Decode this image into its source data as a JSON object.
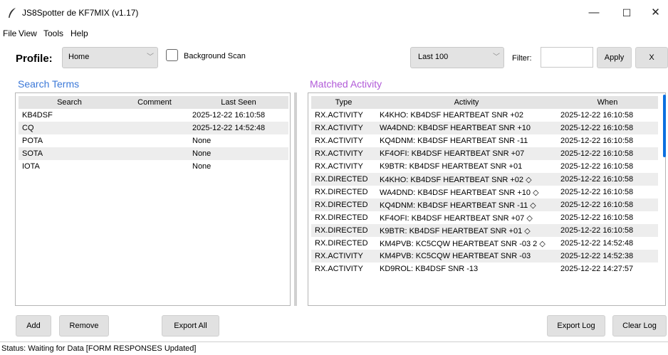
{
  "window": {
    "title": "JS8Spotter de KF7MIX (v1.17)",
    "controls": {
      "minimize": "—",
      "maximize": "☐",
      "close": "✕"
    }
  },
  "menu": {
    "file": "File",
    "view": "View",
    "tools": "Tools",
    "help": "Help"
  },
  "toolbar": {
    "profile_label": "Profile:",
    "profile_value": "Home",
    "background_scan_label": "Background Scan",
    "background_scan_checked": false,
    "range_value": "Last 100",
    "filter_label": "Filter:",
    "filter_value": "",
    "apply_label": "Apply",
    "clear_filter_label": "X"
  },
  "search_terms": {
    "title": "Search Terms",
    "columns": [
      "Search",
      "Comment",
      "Last Seen"
    ],
    "rows": [
      [
        "KB4DSF",
        "",
        "2025-12-22 16:10:58"
      ],
      [
        "CQ",
        "",
        "2025-12-22 14:52:48"
      ],
      [
        "POTA",
        "",
        "None"
      ],
      [
        "SOTA",
        "",
        "None"
      ],
      [
        "IOTA",
        "",
        "None"
      ]
    ]
  },
  "matched_activity": {
    "title": "Matched Activity",
    "columns": [
      "Type",
      "Activity",
      "When"
    ],
    "rows": [
      [
        "RX.ACTIVITY",
        "K4KHO: KB4DSF HEARTBEAT SNR +02",
        "2025-12-22 16:10:58"
      ],
      [
        "RX.ACTIVITY",
        "WA4DND: KB4DSF HEARTBEAT SNR +10",
        "2025-12-22 16:10:58"
      ],
      [
        "RX.ACTIVITY",
        "KQ4DNM: KB4DSF HEARTBEAT SNR -11",
        "2025-12-22 16:10:58"
      ],
      [
        "RX.ACTIVITY",
        "KF4OFI: KB4DSF HEARTBEAT SNR +07",
        "2025-12-22 16:10:58"
      ],
      [
        "RX.ACTIVITY",
        "K9BTR: KB4DSF HEARTBEAT SNR +01",
        "2025-12-22 16:10:58"
      ],
      [
        "RX.DIRECTED",
        "K4KHO: KB4DSF HEARTBEAT SNR +02 ◇",
        "2025-12-22 16:10:58"
      ],
      [
        "RX.DIRECTED",
        "WA4DND: KB4DSF HEARTBEAT SNR +10 ◇",
        "2025-12-22 16:10:58"
      ],
      [
        "RX.DIRECTED",
        "KQ4DNM: KB4DSF HEARTBEAT SNR -11 ◇",
        "2025-12-22 16:10:58"
      ],
      [
        "RX.DIRECTED",
        "KF4OFI: KB4DSF HEARTBEAT SNR +07 ◇",
        "2025-12-22 16:10:58"
      ],
      [
        "RX.DIRECTED",
        "K9BTR: KB4DSF HEARTBEAT SNR +01 ◇",
        "2025-12-22 16:10:58"
      ],
      [
        "RX.DIRECTED",
        "KM4PVB: KC5CQW HEARTBEAT SNR -03 2 ◇",
        "2025-12-22 14:52:48"
      ],
      [
        "RX.ACTIVITY",
        "KM4PVB: KC5CQW HEARTBEAT SNR -03",
        "2025-12-22 14:52:38"
      ],
      [
        "RX.ACTIVITY",
        "KD9ROL: KB4DSF SNR -13",
        "2025-12-22 14:27:57"
      ]
    ]
  },
  "buttons": {
    "add": "Add",
    "remove": "Remove",
    "export_all": "Export All",
    "export_log": "Export Log",
    "clear_log": "Clear Log"
  },
  "status": {
    "text": "Status: Waiting for Data [FORM RESPONSES Updated]"
  },
  "colors": {
    "section_left": "#3b78d8",
    "section_right": "#b15ad8",
    "accent": "#0a6fe0"
  }
}
